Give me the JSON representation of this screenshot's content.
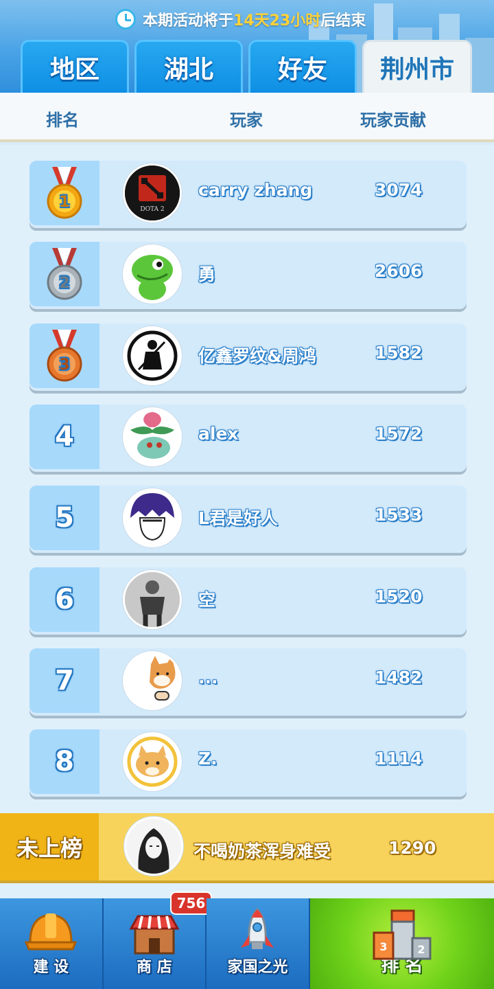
{
  "header": {
    "timer_prefix": "本期活动将于",
    "timer_highlight": "14天23小时",
    "timer_suffix": "后结束",
    "tabs": [
      {
        "label": "地区",
        "active": false
      },
      {
        "label": "湖北",
        "active": false
      },
      {
        "label": "好友",
        "active": false
      },
      {
        "label": "荆州市",
        "active": true
      }
    ]
  },
  "columns": {
    "rank": "排名",
    "player": "玩家",
    "contribution": "玩家贡献"
  },
  "rows": [
    {
      "rank": "1",
      "name": "carry zhang",
      "score": "3074",
      "medal": "gold",
      "avatar": "dota2-logo"
    },
    {
      "rank": "2",
      "name": "勇",
      "score": "2606",
      "medal": "silver",
      "avatar": "green-dinosaur"
    },
    {
      "rank": "3",
      "name": "亿鑫罗纹&周鸿",
      "score": "1582",
      "medal": "bronze",
      "avatar": "warrior-silhouette"
    },
    {
      "rank": "4",
      "name": "alex",
      "score": "1572",
      "avatar": "bulbasaur"
    },
    {
      "rank": "5",
      "name": "L君是好人",
      "score": "1533",
      "avatar": "anime-boy"
    },
    {
      "rank": "6",
      "name": "空",
      "score": "1520",
      "avatar": "person-photo"
    },
    {
      "rank": "7",
      "name": "...",
      "score": "1482",
      "avatar": "shiba-dog"
    },
    {
      "rank": "8",
      "name": "Z.",
      "score": "1114",
      "avatar": "cartoon-cat"
    }
  ],
  "my_row": {
    "label": "未上榜",
    "name": "不喝奶茶浑身难受",
    "score": "1290",
    "avatar": "sketch-portrait"
  },
  "nav": {
    "items": [
      {
        "label": "建 设",
        "icon": "hardhat-icon"
      },
      {
        "label": "商 店",
        "icon": "shop-icon",
        "badge": "756"
      },
      {
        "label": "家国之光",
        "icon": "rocket-icon"
      },
      {
        "label": "排 名",
        "icon": "ranking-podium-icon",
        "active": true
      }
    ]
  },
  "colors": {
    "accent": "#1f8fe4",
    "highlight": "#ffd23a",
    "my_row": "#f7d35c",
    "nav_active": "#6fd21a"
  }
}
